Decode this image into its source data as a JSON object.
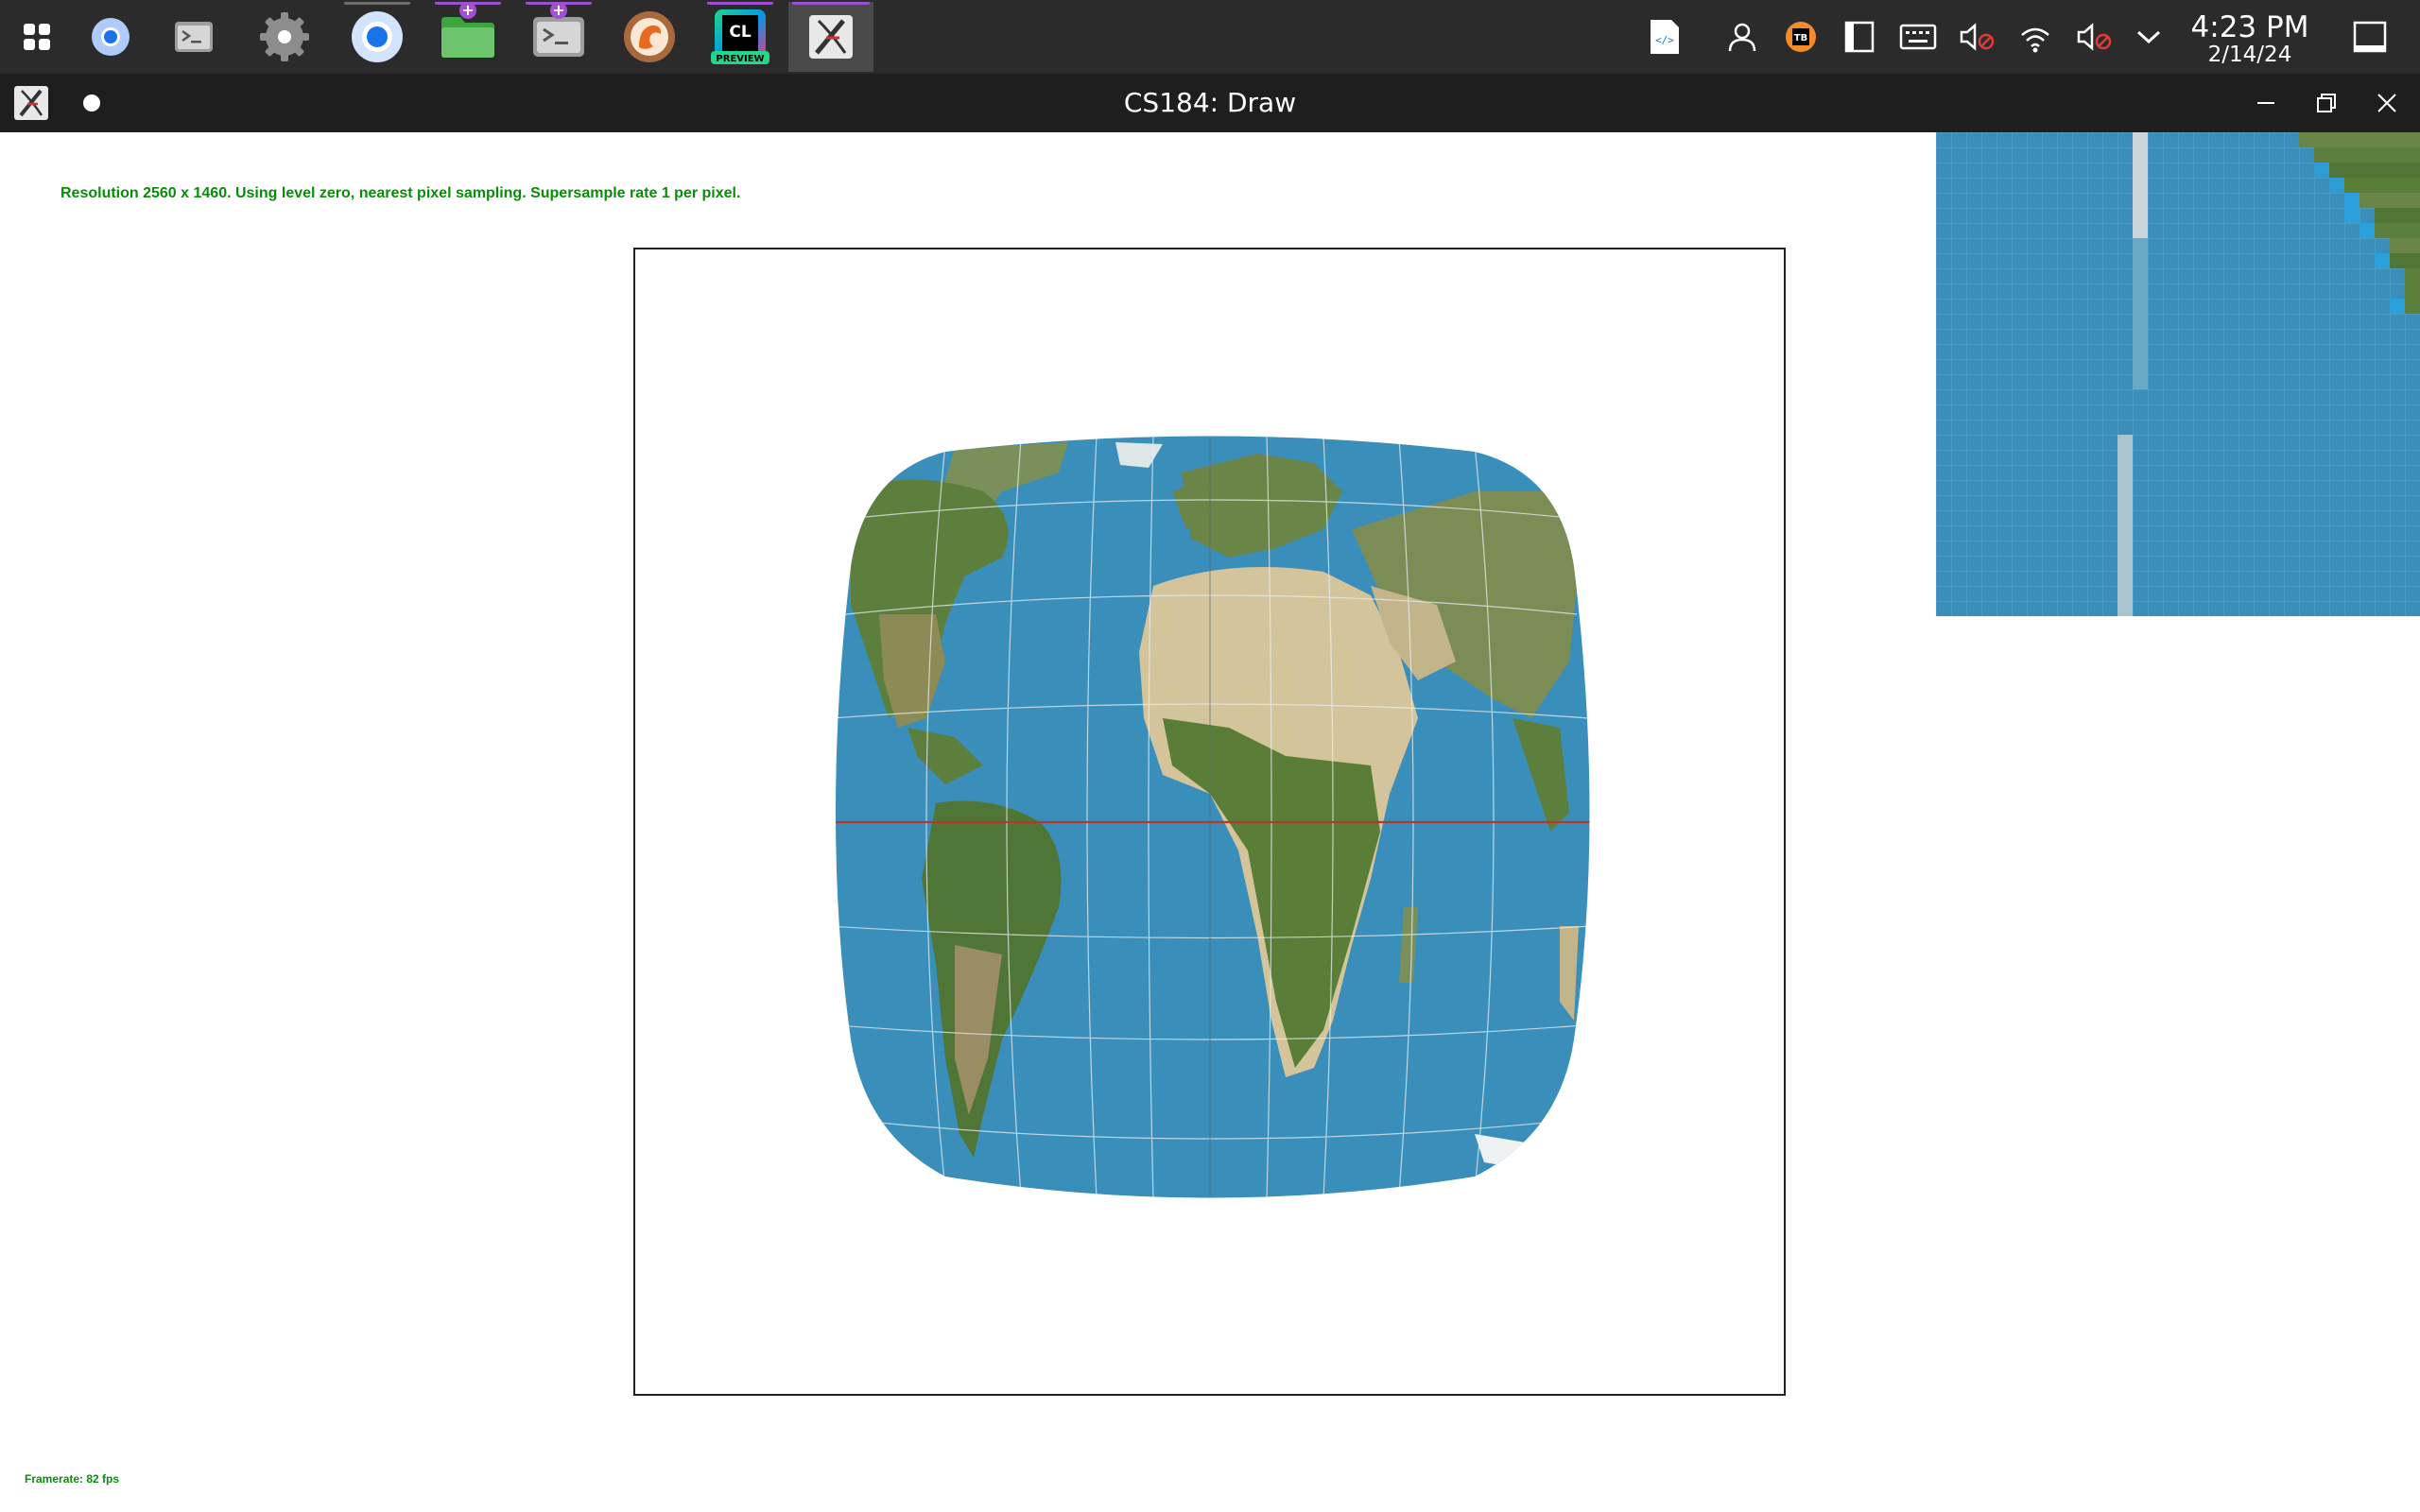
{
  "taskbar": {
    "apps": [
      {
        "name": "launcher",
        "icon": "launcher-grid-icon"
      },
      {
        "name": "chromium",
        "icon": "chromium-icon"
      },
      {
        "name": "terminal",
        "icon": "terminal-icon"
      },
      {
        "name": "settings",
        "icon": "settings-gear-icon"
      },
      {
        "name": "chrome",
        "icon": "chrome-icon"
      },
      {
        "name": "files",
        "icon": "folder-icon"
      },
      {
        "name": "terminal-2",
        "icon": "terminal-icon"
      },
      {
        "name": "browser",
        "icon": "browser-icon"
      },
      {
        "name": "clion-preview",
        "icon": "clion-icon",
        "label_top": "CL",
        "label_bottom": "PREVIEW"
      },
      {
        "name": "xquartz",
        "icon": "x-window-icon"
      }
    ],
    "clock_time": "4:23 PM",
    "clock_date": "2/14/24"
  },
  "window": {
    "title": "CS184: Draw"
  },
  "overlay": {
    "resolution_text": "Resolution 2560 x 1460. Using level zero, nearest pixel sampling. Supersample rate 1 per pixel.",
    "framerate_text": "Framerate: 82 fps"
  },
  "colors": {
    "taskbar_bg": "#2b2b2b",
    "titlebar_bg": "#1e1e1e",
    "overlay_text": "#0a8c0a",
    "ocean": "#3a8fba",
    "land_green": "#5d7f3e",
    "land_desert": "#d4c49c",
    "equator": "#c0392b"
  }
}
